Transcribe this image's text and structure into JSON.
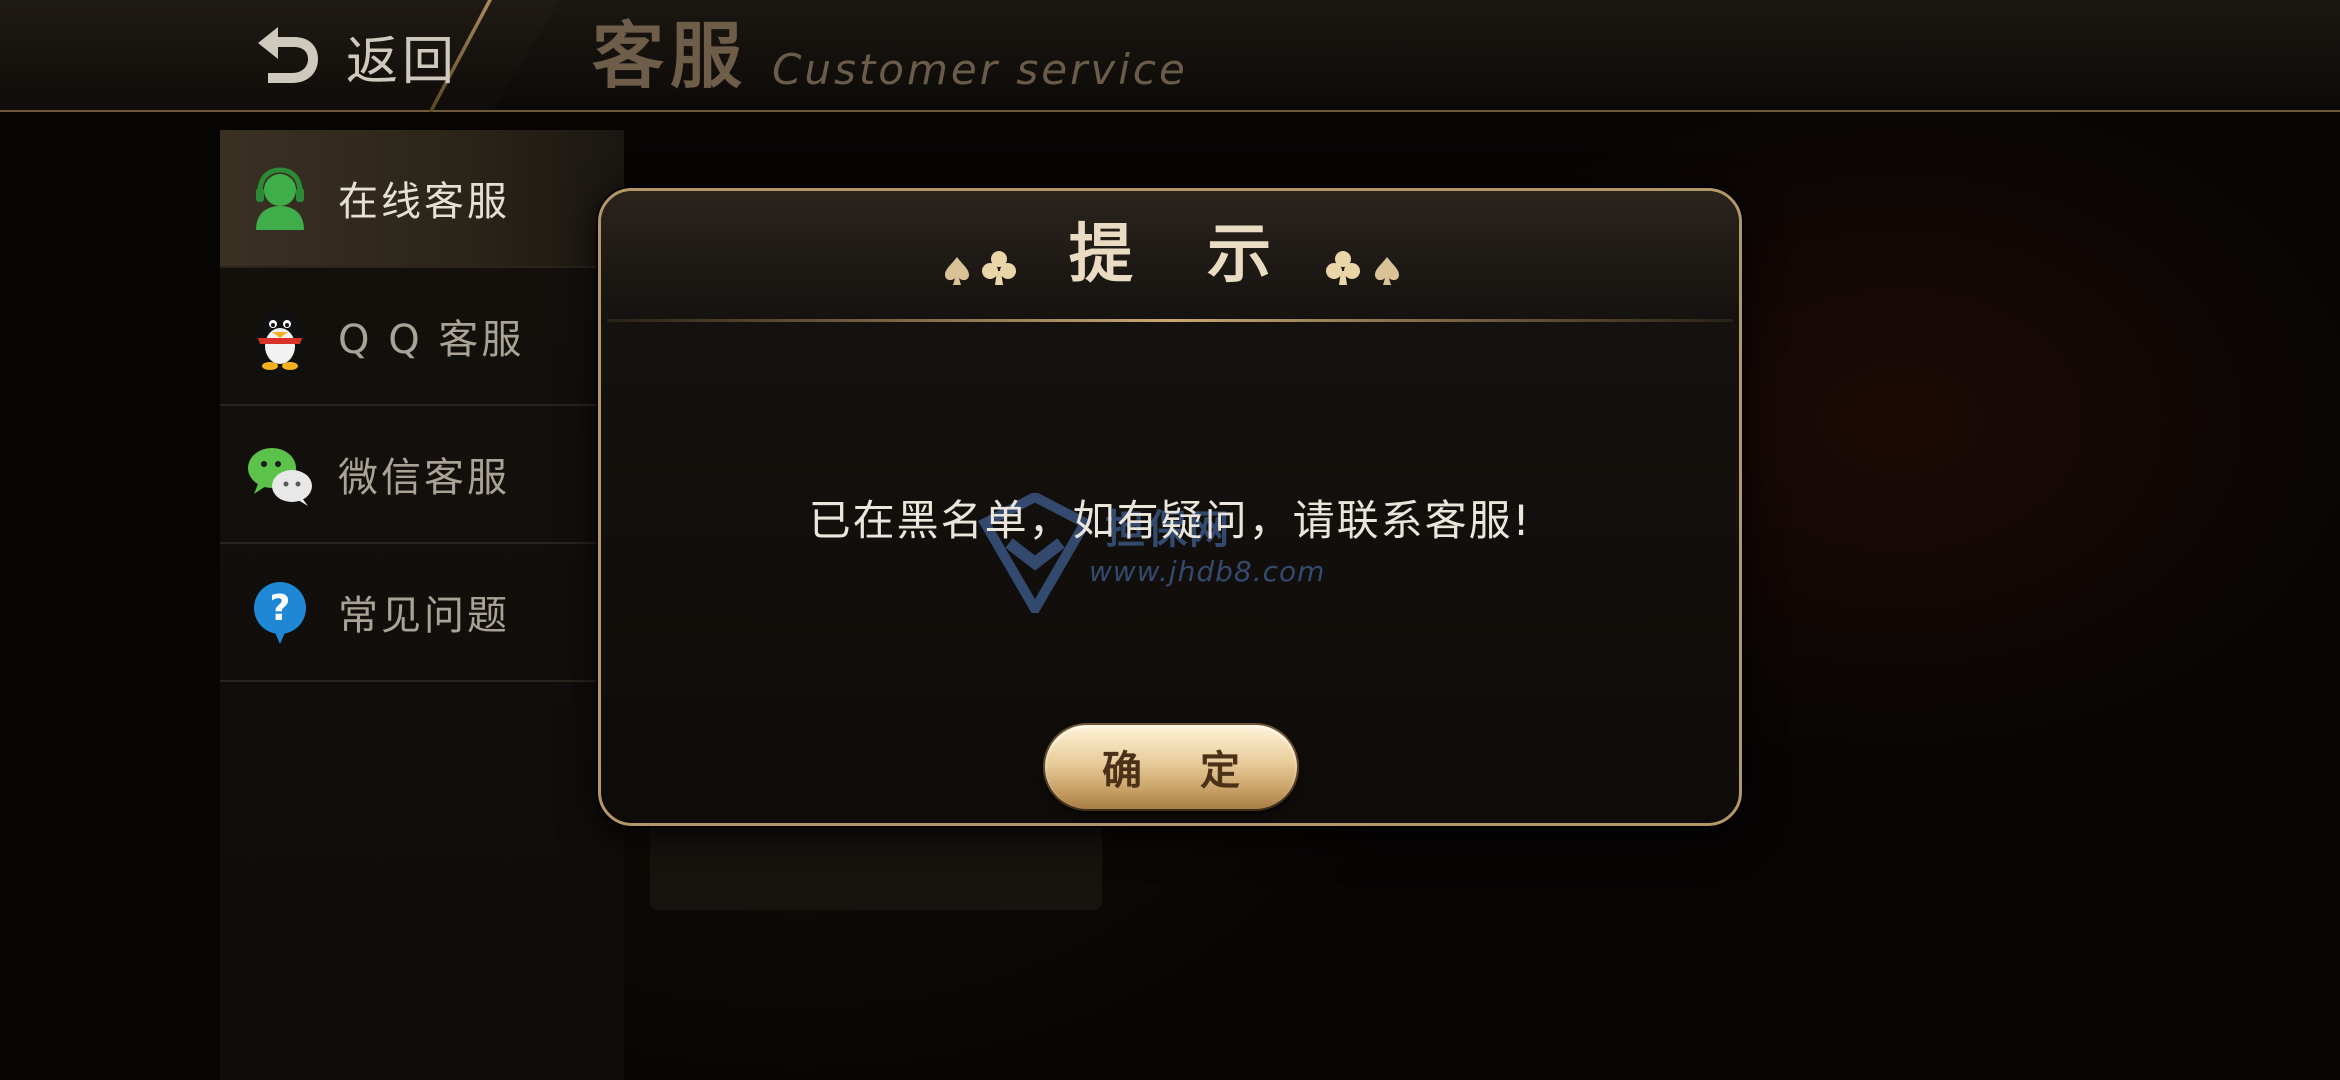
{
  "header": {
    "back_label": "返回",
    "title": "客服",
    "subtitle": "Customer service"
  },
  "sidebar": {
    "items": [
      {
        "label": "在线客服",
        "icon": "headset-agent-icon",
        "active": true
      },
      {
        "label": "Q Q 客服",
        "icon": "qq-penguin-icon",
        "active": false
      },
      {
        "label": "微信客服",
        "icon": "wechat-icon",
        "active": false
      },
      {
        "label": "常见问题",
        "icon": "question-bubble-icon",
        "active": false
      }
    ]
  },
  "modal": {
    "title": "提 示",
    "message": "已在黑名单，如有疑问，请联系客服!",
    "confirm_label": "确 定",
    "watermark_url": "www.jhdb8.com",
    "watermark_text": "担保网"
  },
  "colors": {
    "gold_border": "#b49767",
    "accent_green": "#3fae4a",
    "qq_red": "#d9322a",
    "wechat_green": "#5cc24a",
    "question_blue": "#1e88d6"
  }
}
